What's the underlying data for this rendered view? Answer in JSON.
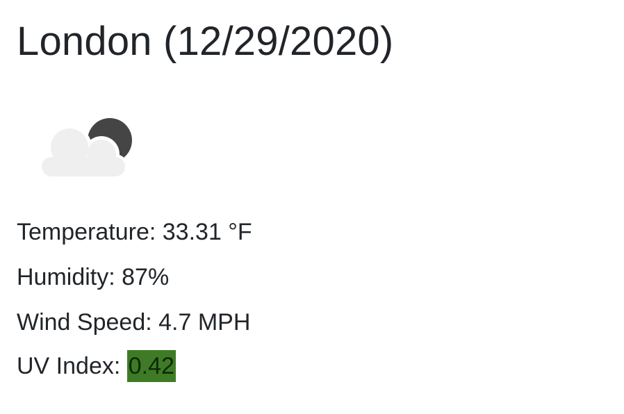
{
  "header": {
    "title": "London (12/29/2020)"
  },
  "weather_icon": {
    "name": "cloud-moon-icon"
  },
  "stats": {
    "temperature_label": "Temperature: ",
    "temperature_value": "33.31 °F",
    "humidity_label": "Humidity: ",
    "humidity_value": "87%",
    "wind_label": "Wind Speed: ",
    "wind_value": "4.7 MPH",
    "uv_label": "UV Index: ",
    "uv_value": "0.42",
    "uv_color": "#3f7b26"
  }
}
